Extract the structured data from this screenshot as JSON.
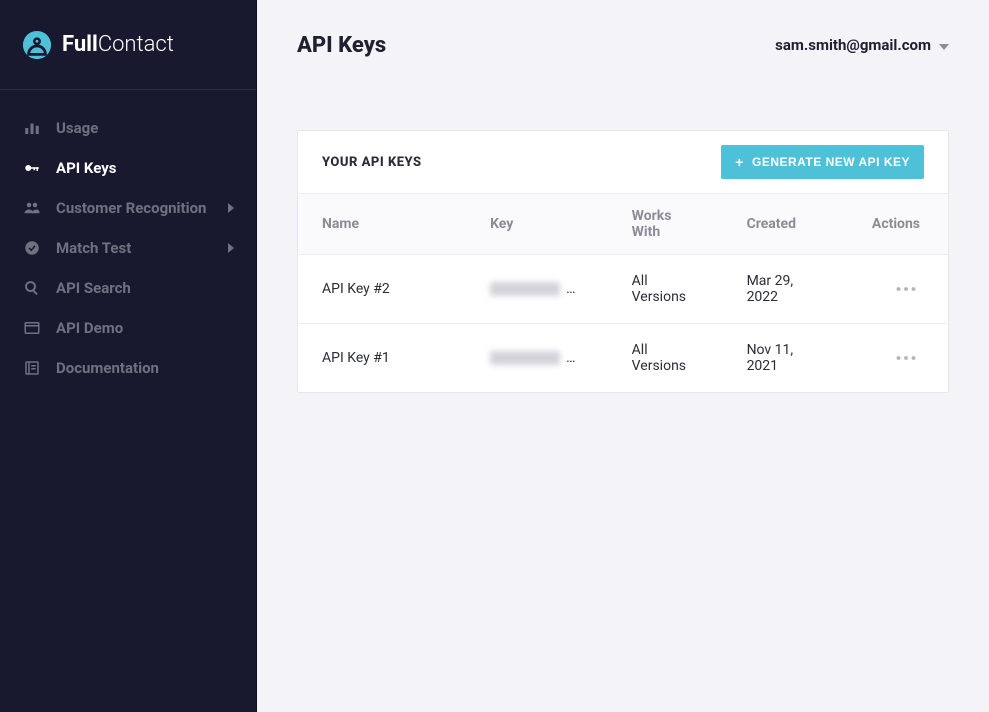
{
  "brand": {
    "name_strong": "Full",
    "name_thin": "Contact"
  },
  "sidebar": {
    "items": [
      {
        "label": "Usage"
      },
      {
        "label": "API Keys"
      },
      {
        "label": "Customer Recognition"
      },
      {
        "label": "Match Test"
      },
      {
        "label": "API Search"
      },
      {
        "label": "API Demo"
      },
      {
        "label": "Documentation"
      }
    ]
  },
  "header": {
    "title": "API Keys",
    "user_email": "sam.smith@gmail.com"
  },
  "card": {
    "title": "YOUR API KEYS",
    "button_label": "GENERATE NEW API KEY"
  },
  "table": {
    "columns": {
      "name": "Name",
      "key": "Key",
      "works_with": "Works With",
      "created": "Created",
      "actions": "Actions"
    },
    "rows": [
      {
        "name": "API Key #2",
        "works_with": "All Versions",
        "created": "Mar 29, 2022"
      },
      {
        "name": "API Key #1",
        "works_with": "All Versions",
        "created": "Nov 11, 2021"
      }
    ]
  }
}
